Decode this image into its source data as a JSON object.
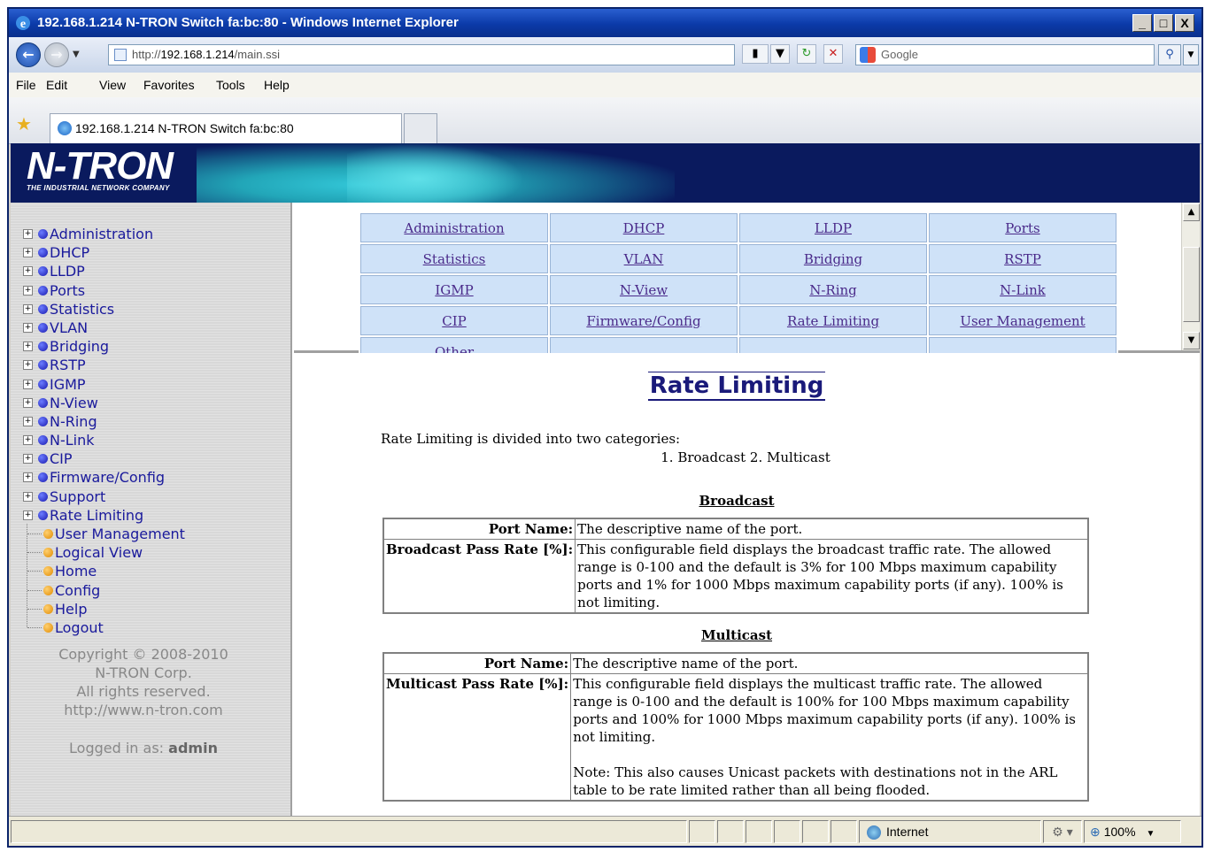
{
  "window": {
    "title": "192.168.1.214 N-TRON Switch fa:bc:80 - Windows Internet Explorer",
    "buttons": [
      "_",
      "□",
      "X"
    ]
  },
  "address": {
    "url_prefix": "http://",
    "url_host": "192.168.1.214",
    "url_path": "/main.ssi",
    "search_placeholder": "Google"
  },
  "menu": [
    "File",
    "Edit",
    "View",
    "Favorites",
    "Tools",
    "Help"
  ],
  "tab": {
    "label": "192.168.1.214 N-TRON Switch fa:bc:80"
  },
  "banner": {
    "logo": "N-TRON",
    "tagline": "THE INDUSTRIAL NETWORK COMPANY"
  },
  "sidebar": {
    "items": [
      {
        "label": "Administration",
        "type": "folder"
      },
      {
        "label": "DHCP",
        "type": "folder"
      },
      {
        "label": "LLDP",
        "type": "folder"
      },
      {
        "label": "Ports",
        "type": "folder"
      },
      {
        "label": "Statistics",
        "type": "folder"
      },
      {
        "label": "VLAN",
        "type": "folder"
      },
      {
        "label": "Bridging",
        "type": "folder"
      },
      {
        "label": "RSTP",
        "type": "folder"
      },
      {
        "label": "IGMP",
        "type": "folder"
      },
      {
        "label": "N-View",
        "type": "folder"
      },
      {
        "label": "N-Ring",
        "type": "folder"
      },
      {
        "label": "N-Link",
        "type": "folder"
      },
      {
        "label": "CIP",
        "type": "folder"
      },
      {
        "label": "Firmware/Config",
        "type": "folder"
      },
      {
        "label": "Support",
        "type": "folder"
      },
      {
        "label": "Rate Limiting",
        "type": "folder"
      },
      {
        "label": "User Management",
        "type": "page"
      },
      {
        "label": "Logical View",
        "type": "page"
      },
      {
        "label": "Home",
        "type": "page"
      },
      {
        "label": "Config",
        "type": "page"
      },
      {
        "label": "Help",
        "type": "page"
      },
      {
        "label": "Logout",
        "type": "page"
      }
    ],
    "copyright": [
      "Copyright © 2008-2010",
      "N-TRON Corp.",
      "All rights reserved.",
      "http://www.n-tron.com"
    ],
    "logged_in_label": "Logged in as:",
    "logged_in_user": "admin"
  },
  "help_links": [
    [
      "Administration",
      "DHCP",
      "LLDP",
      "Ports"
    ],
    [
      "Statistics",
      "VLAN",
      "Bridging",
      "RSTP"
    ],
    [
      "IGMP",
      "N-View",
      "N-Ring",
      "N-Link"
    ],
    [
      "CIP",
      "Firmware/Config",
      "Rate Limiting",
      "User Management"
    ],
    [
      "Other",
      "",
      "",
      ""
    ]
  ],
  "main": {
    "title": "Rate Limiting",
    "intro": "Rate Limiting is divided into two categories:",
    "categories": "1. Broadcast  2. Multicast",
    "broadcast": {
      "heading": "Broadcast",
      "rows": [
        {
          "key": "Port Name:",
          "value": "The descriptive name of the port."
        },
        {
          "key": "Broadcast Pass Rate [%]:",
          "value": "This configurable field displays the broadcast traffic rate. The allowed range is 0-100 and the default is 3% for 100 Mbps maximum capability ports and 1% for 1000 Mbps maximum capability ports (if any). 100% is not limiting."
        }
      ]
    },
    "multicast": {
      "heading": "Multicast",
      "rows": [
        {
          "key": "Port Name:",
          "value": "The descriptive name of the port."
        },
        {
          "key": "Multicast Pass Rate [%]:",
          "value": "This configurable field displays the multicast traffic rate. The allowed range is 0-100 and the default is 100% for 100 Mbps maximum capability ports and 100% for 1000 Mbps maximum capability ports (if any). 100% is not limiting.",
          "note": "Note: This also causes Unicast packets with destinations not in the ARL table to be rate limited rather than all being flooded."
        }
      ]
    }
  },
  "status": {
    "zone": "Internet",
    "zoom": "100%"
  }
}
